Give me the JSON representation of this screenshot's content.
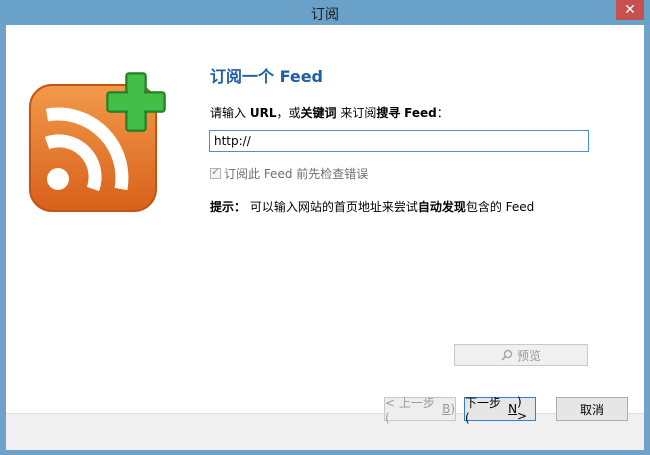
{
  "window": {
    "title": "订阅",
    "close_glyph": "✕"
  },
  "icon": {
    "name": "rss-add-icon",
    "colors": {
      "orange": "#e8731e",
      "green": "#2fa336"
    }
  },
  "heading": "订阅一个 Feed",
  "prompt": {
    "p1": "请输入 ",
    "url": "URL",
    "p2": "，或",
    "keyword": "关键词",
    "p3": " 来订阅",
    "search": "搜寻",
    "space": " ",
    "feed": "Feed",
    "colon": "："
  },
  "url_input": {
    "value": "http://"
  },
  "check_option": {
    "label": "订阅此 Feed 前先检查错误",
    "checked": true
  },
  "tip": {
    "label": "提示：",
    "p1": " 可以输入网站的首页地址来尝试",
    "auto": "自动发现",
    "p2": "包含的 Feed"
  },
  "preview_button": {
    "label": "预览",
    "icon": "magnifier-icon"
  },
  "buttons": {
    "back": {
      "pre": "< 上一步 (",
      "key": "B",
      "post": ")"
    },
    "next": {
      "pre": "下一步 (",
      "key": "N",
      "post": ") >"
    },
    "cancel": "取消"
  }
}
